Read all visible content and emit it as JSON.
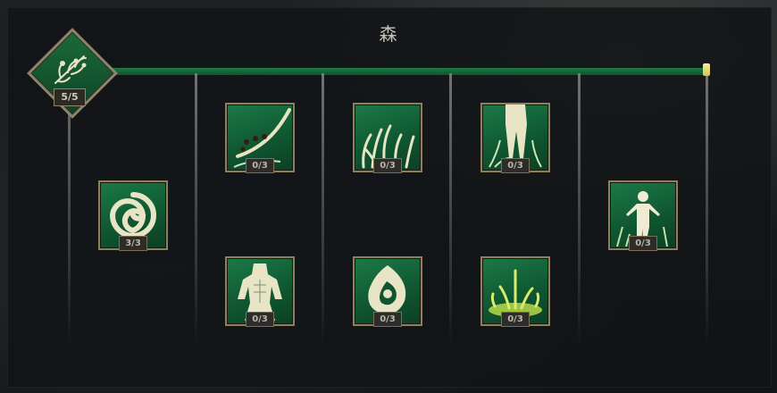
{
  "tree": {
    "title": "森",
    "progress": 1.0
  },
  "root_skill": {
    "icon": "forest-grass-icon",
    "rank": "5/5"
  },
  "skills": [
    {
      "icon": "spiral-vortex-icon",
      "rank": "3/3"
    },
    {
      "icon": "thorn-vine-icon",
      "rank": "0/3"
    },
    {
      "icon": "spiked-grass-icon",
      "rank": "0/3"
    },
    {
      "icon": "rooted-figure-icon",
      "rank": "0/3"
    },
    {
      "icon": "standing-figure-icon",
      "rank": "0/3"
    },
    {
      "icon": "muscle-figure-icon",
      "rank": "0/3"
    },
    {
      "icon": "seed-sprout-icon",
      "rank": "0/3"
    },
    {
      "icon": "sprouting-ground-icon",
      "rank": "0/3"
    }
  ]
}
